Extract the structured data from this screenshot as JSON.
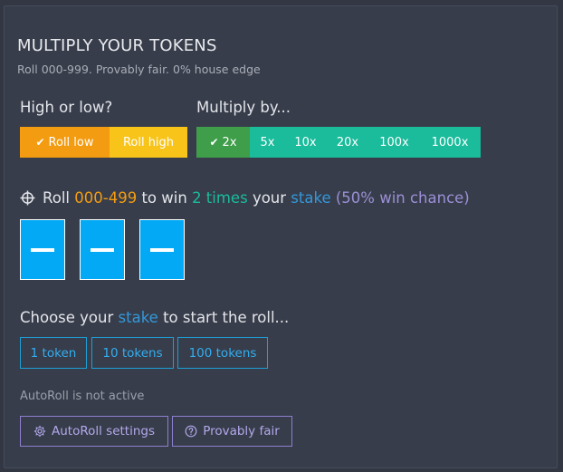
{
  "header": {
    "title": "MULTIPLY YOUR TOKENS",
    "subtitle": "Roll 000-999. Provably fair. 0% house edge"
  },
  "direction": {
    "label": "High or low?",
    "options": [
      {
        "label": "Roll low",
        "selected": true
      },
      {
        "label": "Roll high",
        "selected": false
      }
    ]
  },
  "multiplier": {
    "label": "Multiply by...",
    "options": [
      {
        "label": "2x",
        "selected": true
      },
      {
        "label": "5x",
        "selected": false
      },
      {
        "label": "10x",
        "selected": false
      },
      {
        "label": "20x",
        "selected": false
      },
      {
        "label": "100x",
        "selected": false
      },
      {
        "label": "1000x",
        "selected": false
      }
    ]
  },
  "roll_info": {
    "prefix": "Roll",
    "range": "000-499",
    "to_win": "to win",
    "times": "2 times",
    "your": "your",
    "stake_word": "stake",
    "chance": "(50% win chance)"
  },
  "digits": [
    "—",
    "—",
    "—"
  ],
  "stake": {
    "prompt_prefix": "Choose your",
    "prompt_stake": "stake",
    "prompt_suffix": "to start the roll...",
    "options": [
      "1 token",
      "10 tokens",
      "100 tokens"
    ]
  },
  "autoroll": {
    "status": "AutoRoll is not active",
    "settings_label": "AutoRoll settings",
    "provably_fair_label": "Provably fair"
  },
  "colors": {
    "roll_low": "#f39c12",
    "roll_high": "#f8c41a",
    "multiplier": "#1abc9c",
    "multiplier_active": "#3f9e4a",
    "digit_box": "#03a9f4",
    "stake_outline": "#1e9fd6",
    "purple_outline": "#8e7fd0"
  }
}
